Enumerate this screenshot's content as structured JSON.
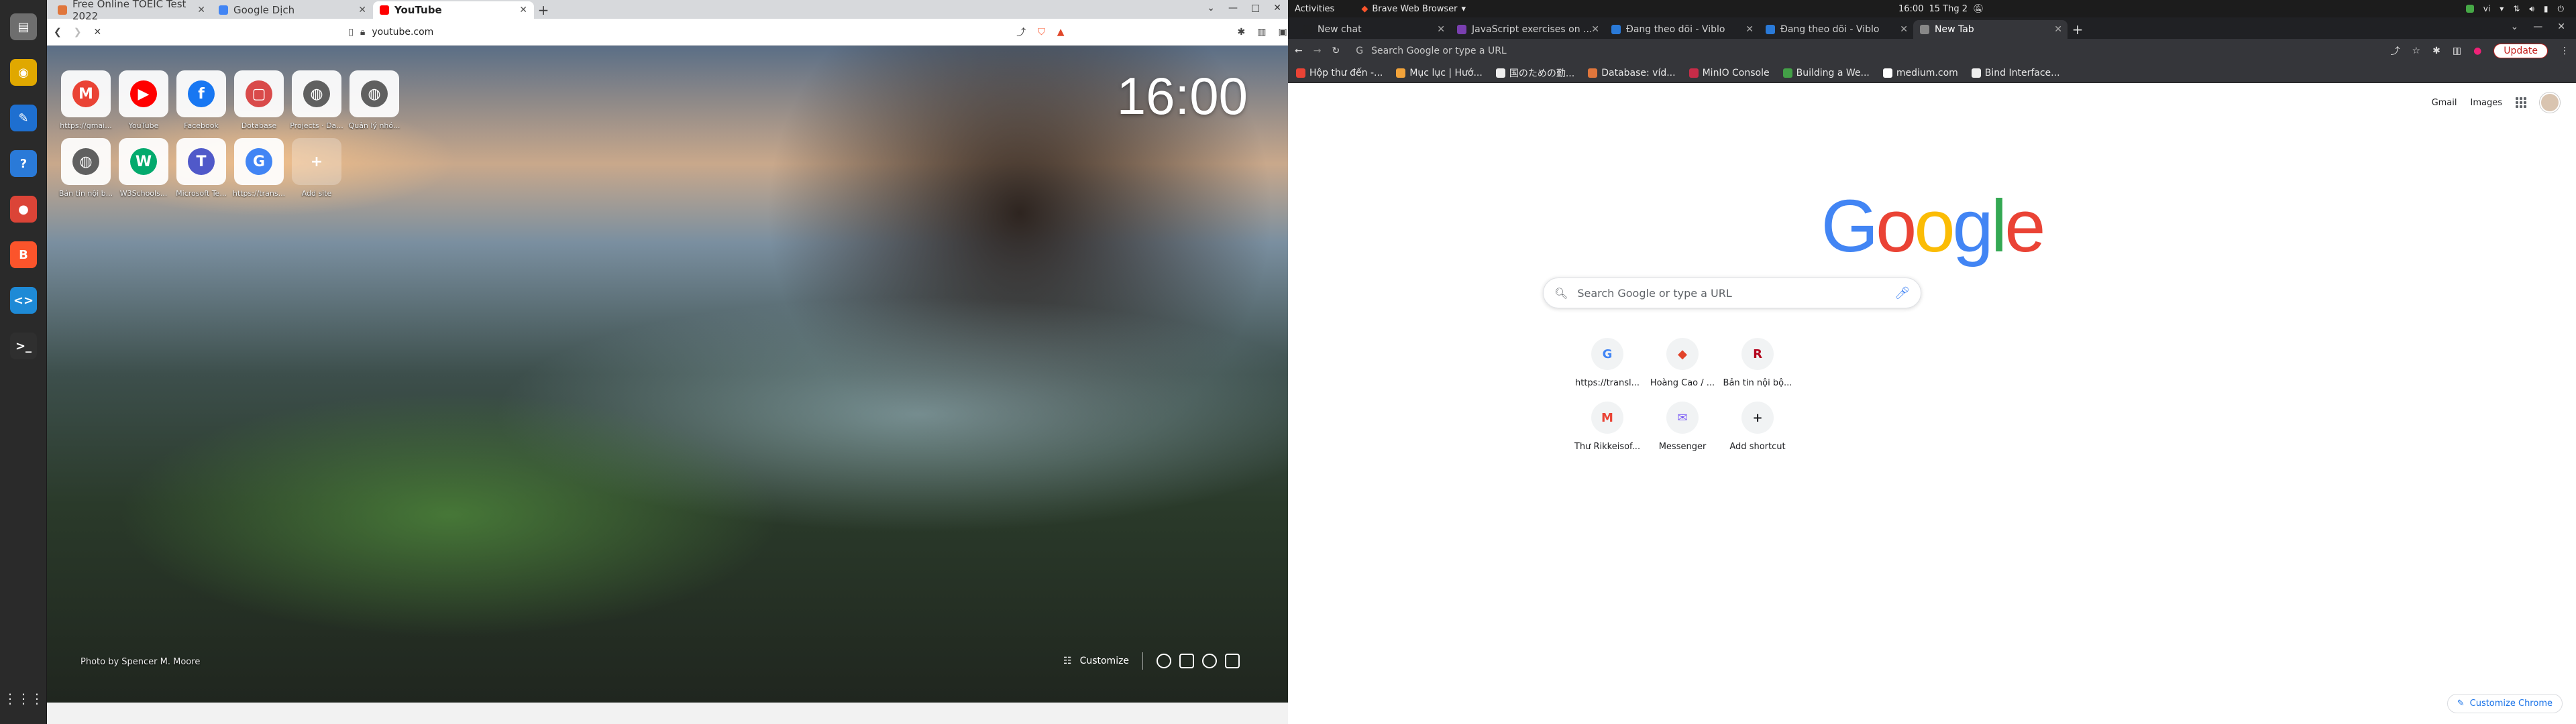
{
  "topbar": {
    "activities": "Activities",
    "app_menu": "Brave Web Browser",
    "time": "16:00",
    "date": "15 Thg 2",
    "lang": "vi"
  },
  "dock": {
    "items": [
      {
        "name": "files",
        "glyph": "▤",
        "color": "#6e6e6e"
      },
      {
        "name": "rhythmbox",
        "glyph": "◉",
        "color": "#e0a800"
      },
      {
        "name": "writer",
        "glyph": "✎",
        "color": "#1e6fd0"
      },
      {
        "name": "help",
        "glyph": "?",
        "color": "#2a7ad8"
      },
      {
        "name": "chrome",
        "glyph": "●",
        "color": "#db4437"
      },
      {
        "name": "brave",
        "glyph": "B",
        "color": "#fb542b"
      },
      {
        "name": "vscode",
        "glyph": "<>",
        "color": "#1e8ad6"
      },
      {
        "name": "terminal",
        "glyph": ">_",
        "color": "#2f2f2f"
      }
    ],
    "apps_grid": "⋮⋮⋮"
  },
  "left_browser": {
    "tabs": [
      {
        "label": "Free Online TOEIC Test 2022",
        "color": "#e0763c"
      },
      {
        "label": "Google Dịch",
        "color": "#4285f4"
      },
      {
        "label": "YouTube",
        "color": "#ff0000"
      }
    ],
    "url": "youtube.com",
    "tiles": [
      {
        "label": "https://gmai...",
        "glyph": "M",
        "color": "#ea4335"
      },
      {
        "label": "YouTube",
        "glyph": "▶",
        "color": "#ff0000"
      },
      {
        "label": "Facebook",
        "glyph": "f",
        "color": "#1877f2"
      },
      {
        "label": "Dotabase",
        "glyph": "▢",
        "color": "#d94a4a"
      },
      {
        "label": "Projects · Da...",
        "glyph": "◍",
        "color": "#606060"
      },
      {
        "label": "Quản lý nhó...",
        "glyph": "◍",
        "color": "#606060"
      },
      {
        "label": "Bản tin nội b...",
        "glyph": "◍",
        "color": "#606060"
      },
      {
        "label": "W3Schools...",
        "glyph": "W",
        "color": "#04aa6d"
      },
      {
        "label": "Microsoft Te...",
        "glyph": "T",
        "color": "#5059c9"
      },
      {
        "label": "https://trans...",
        "glyph": "G",
        "color": "#4285f4"
      },
      {
        "label": "Add site",
        "glyph": "+",
        "color": "transparent"
      }
    ],
    "clock": "16:00",
    "photo_credit": "Photo by Spencer M. Moore",
    "customize": "Customize"
  },
  "right_browser": {
    "tabs": [
      {
        "label": "New chat",
        "color": "#202123"
      },
      {
        "label": "JavaScript exercises on ...",
        "color": "#7a3fb0"
      },
      {
        "label": "Đang theo dõi - Viblo",
        "color": "#2a7ad8"
      },
      {
        "label": "Đang theo dõi - Viblo",
        "color": "#2a7ad8"
      },
      {
        "label": "New Tab",
        "color": "#888888"
      }
    ],
    "omnibox_placeholder": "Search Google or type a URL",
    "update": "Update",
    "bookmarks": [
      {
        "label": "Hộp thư đến -...",
        "color": "#ea4335"
      },
      {
        "label": "Mục lục | Hướ...",
        "color": "#f2a33a"
      },
      {
        "label": "国のための勤...",
        "color": "#eeeeee"
      },
      {
        "label": "Database: víd...",
        "color": "#e0763c"
      },
      {
        "label": "MinIO Console",
        "color": "#c72c48"
      },
      {
        "label": "Building a We...",
        "color": "#43a047"
      },
      {
        "label": "medium.com",
        "color": "#ffffff"
      },
      {
        "label": "Bind Interface...",
        "color": "#eeeeee"
      }
    ],
    "gmail": "Gmail",
    "images": "Images",
    "logo_letters": [
      {
        "ch": "G",
        "color": "#4285f4"
      },
      {
        "ch": "o",
        "color": "#ea4335"
      },
      {
        "ch": "o",
        "color": "#fbbc05"
      },
      {
        "ch": "g",
        "color": "#4285f4"
      },
      {
        "ch": "l",
        "color": "#34a853"
      },
      {
        "ch": "e",
        "color": "#ea4335"
      }
    ],
    "search_placeholder": "Search Google or type a URL",
    "shortcuts": [
      {
        "label": "https://transl...",
        "glyph": "G",
        "color": "#4285f4"
      },
      {
        "label": "Hoàng Cao / ...",
        "glyph": "◆",
        "color": "#e2432a"
      },
      {
        "label": "Bản tin nội bộ...",
        "glyph": "R",
        "color": "#b3001b"
      },
      {
        "label": "Thư Rikkeisof...",
        "glyph": "M",
        "color": "#ea4335"
      },
      {
        "label": "Messenger",
        "glyph": "✉",
        "color": "#7b5cf5"
      },
      {
        "label": "Add shortcut",
        "glyph": "+",
        "color": "#202124"
      }
    ],
    "customize_chrome": "Customize Chrome"
  }
}
